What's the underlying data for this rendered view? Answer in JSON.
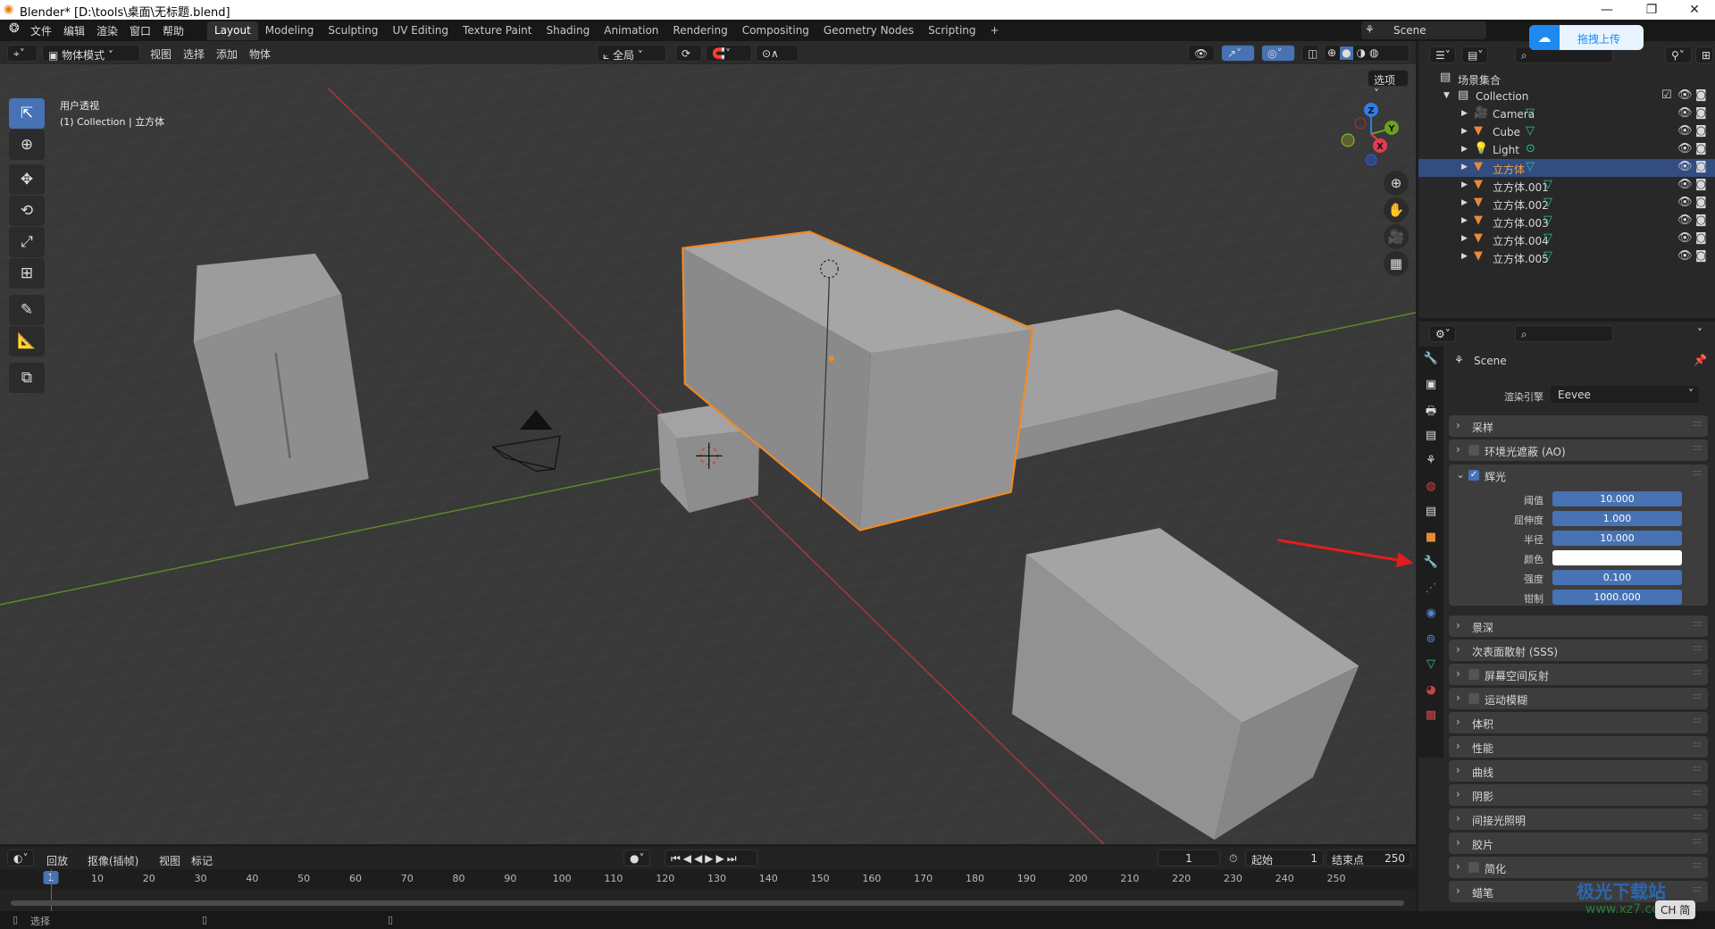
{
  "window": {
    "title": "Blender* [D:\\tools\\桌面\\无标题.blend]",
    "controls": [
      "—",
      "❐",
      "✕"
    ]
  },
  "menubar": {
    "items": [
      "文件",
      "编辑",
      "渲染",
      "窗口",
      "帮助"
    ],
    "workspaces": [
      "Layout",
      "Modeling",
      "Sculpting",
      "UV Editing",
      "Texture Paint",
      "Shading",
      "Animation",
      "Rendering",
      "Compositing",
      "Geometry Nodes",
      "Scripting",
      "+"
    ],
    "active_workspace": "Layout",
    "scene": "Scene",
    "upload_label": "拖拽上传"
  },
  "viewport_header": {
    "mode": "物体模式",
    "menus": [
      "视图",
      "选择",
      "添加",
      "物体"
    ],
    "orientation": "全局",
    "options": "选项"
  },
  "viewport": {
    "view_name": "用户透视",
    "context": "(1) Collection | 立方体",
    "gizmo": {
      "z": "Z",
      "y": "Y",
      "x": "X"
    },
    "selection_color": "#f08a24",
    "x_axis_color": "#c8404a",
    "y_axis_color": "#6a9a2a"
  },
  "outliner": {
    "root": "场景集合",
    "collection": "Collection",
    "items": [
      {
        "name": "Camera",
        "type": "camera"
      },
      {
        "name": "Cube",
        "type": "mesh"
      },
      {
        "name": "Light",
        "type": "light"
      },
      {
        "name": "立方体",
        "type": "mesh",
        "selected": true
      },
      {
        "name": "立方体.001",
        "type": "mesh"
      },
      {
        "name": "立方体.002",
        "type": "mesh"
      },
      {
        "name": "立方体.003",
        "type": "mesh"
      },
      {
        "name": "立方体.004",
        "type": "mesh"
      },
      {
        "name": "立方体.005",
        "type": "mesh"
      }
    ]
  },
  "properties": {
    "scene": "Scene",
    "engine_label": "渲染引擎",
    "engine": "Eevee",
    "panels_top": [
      {
        "label": "采样",
        "checkbox": false
      },
      {
        "label": "环境光遮蔽 (AO)",
        "checkbox": true,
        "checked": false
      }
    ],
    "bloom": {
      "label": "辉光",
      "checked": true,
      "fields": [
        {
          "label": "阈值",
          "value": "10.000"
        },
        {
          "label": "屈伸度",
          "value": "1.000"
        },
        {
          "label": "半径",
          "value": "10.000"
        },
        {
          "label": "颜色",
          "value": "",
          "color": "#ffffff"
        },
        {
          "label": "强度",
          "value": "0.100"
        },
        {
          "label": "钳制",
          "value": "1000.000"
        }
      ]
    },
    "panels_bottom": [
      {
        "label": "景深"
      },
      {
        "label": "次表面散射 (SSS)"
      },
      {
        "label": "屏幕空间反射",
        "checkbox": true
      },
      {
        "label": "运动模糊",
        "checkbox": true
      },
      {
        "label": "体积"
      },
      {
        "label": "性能"
      },
      {
        "label": "曲线"
      },
      {
        "label": "阴影"
      },
      {
        "label": "间接光照明"
      },
      {
        "label": "胶片"
      },
      {
        "label": "简化",
        "checkbox": true
      },
      {
        "label": "蜡笔"
      }
    ]
  },
  "timeline": {
    "menus": [
      "回放",
      "抠像(插帧)",
      "视图",
      "标记"
    ],
    "current_frame": "1",
    "start_label": "起始",
    "start": "1",
    "end_label": "结束点",
    "end": "250",
    "ticks": [
      1,
      10,
      20,
      30,
      40,
      50,
      60,
      70,
      80,
      90,
      100,
      110,
      120,
      130,
      140,
      150,
      160,
      170,
      180,
      190,
      200,
      210,
      220,
      230,
      240,
      250
    ]
  },
  "statusbar": {
    "select": "选择"
  },
  "watermark": {
    "text": "极光下载站",
    "url": "www.xz7.com",
    "ime": "CH 简"
  }
}
